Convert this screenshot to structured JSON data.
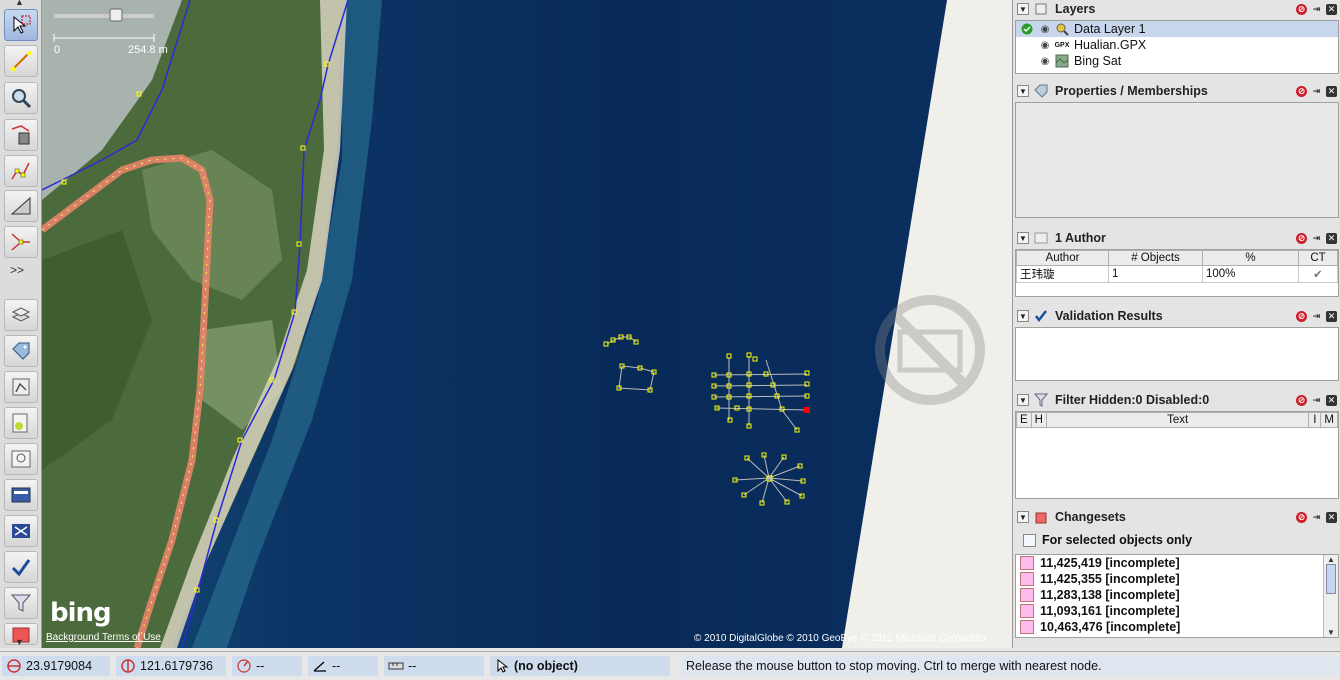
{
  "toolbar": {
    "more_label": ">>",
    "tools": [
      {
        "name": "select-tool-button",
        "icon": "select-icon",
        "active": true
      },
      {
        "name": "draw-tool-button",
        "icon": "draw-line-icon"
      },
      {
        "name": "zoom-tool-button",
        "icon": "zoom-icon"
      },
      {
        "name": "delete-tool-button",
        "icon": "delete-icon"
      },
      {
        "name": "split-way-button",
        "icon": "split-way-icon"
      },
      {
        "name": "align-button",
        "icon": "align-icon"
      },
      {
        "name": "combine-way-button",
        "icon": "combine-way-icon"
      }
    ],
    "dialog_tools": [
      {
        "name": "toggle-layers-button",
        "icon": "layers-icon"
      },
      {
        "name": "toggle-tags-button",
        "icon": "tag-icon"
      },
      {
        "name": "toggle-selection-button",
        "icon": "selection-icon"
      },
      {
        "name": "toggle-commands-button",
        "icon": "commands-icon"
      },
      {
        "name": "toggle-authors-button",
        "icon": "authors-icon"
      },
      {
        "name": "toggle-relations-button",
        "icon": "relations-icon"
      },
      {
        "name": "toggle-conflicts-button",
        "icon": "conflicts-icon"
      },
      {
        "name": "toggle-validation-button",
        "icon": "checkmark-icon"
      },
      {
        "name": "toggle-filter-button",
        "icon": "filter-icon"
      }
    ]
  },
  "map": {
    "scale_min": "0",
    "scale_max": "254.8 m",
    "bing_logo": "bing",
    "terms": "Background Terms of Use",
    "copyright": "© 2010 DigitalGlobe © 2010 GeoEye © 2012 Microsoft Corporatio"
  },
  "layers": {
    "title": "Layers",
    "items": [
      {
        "label": "Data Layer 1",
        "icon": "data-layer-icon",
        "active": true
      },
      {
        "label": "Hualian.GPX",
        "icon": "gpx-icon",
        "icon_text": "GPX"
      },
      {
        "label": "Bing Sat",
        "icon": "imagery-icon"
      }
    ]
  },
  "properties": {
    "title": "Properties / Memberships"
  },
  "authors": {
    "title": "1 Author",
    "columns": [
      "Author",
      "# Objects",
      "%",
      "CT"
    ],
    "rows": [
      {
        "author": "王玮璇",
        "objects": "1",
        "percent": "100%"
      }
    ]
  },
  "validation": {
    "title": "Validation Results"
  },
  "filter": {
    "title": "Filter Hidden:0 Disabled:0",
    "columns": [
      "E",
      "H",
      "Text",
      "I",
      "M"
    ]
  },
  "changesets": {
    "title": "Changesets",
    "checkbox_label": "For selected objects only",
    "items": [
      "11,425,419 [incomplete]",
      "11,425,355 [incomplete]",
      "11,283,138 [incomplete]",
      "11,093,161 [incomplete]",
      "10,463,476 [incomplete]"
    ]
  },
  "status": {
    "lat": "23.9179084",
    "lon": "121.6179736",
    "heading": "--",
    "angle": "--",
    "distance": "--",
    "selection": "(no object)",
    "message": "Release the mouse button to stop moving. Ctrl to merge with nearest node."
  },
  "colors": {
    "selection_blue": "#c7d6ec",
    "way_yellow": "#ffff00",
    "gpx_track": "#e8846a",
    "coastline_blue": "#2b2bd6",
    "close_red": "#c9202a"
  }
}
